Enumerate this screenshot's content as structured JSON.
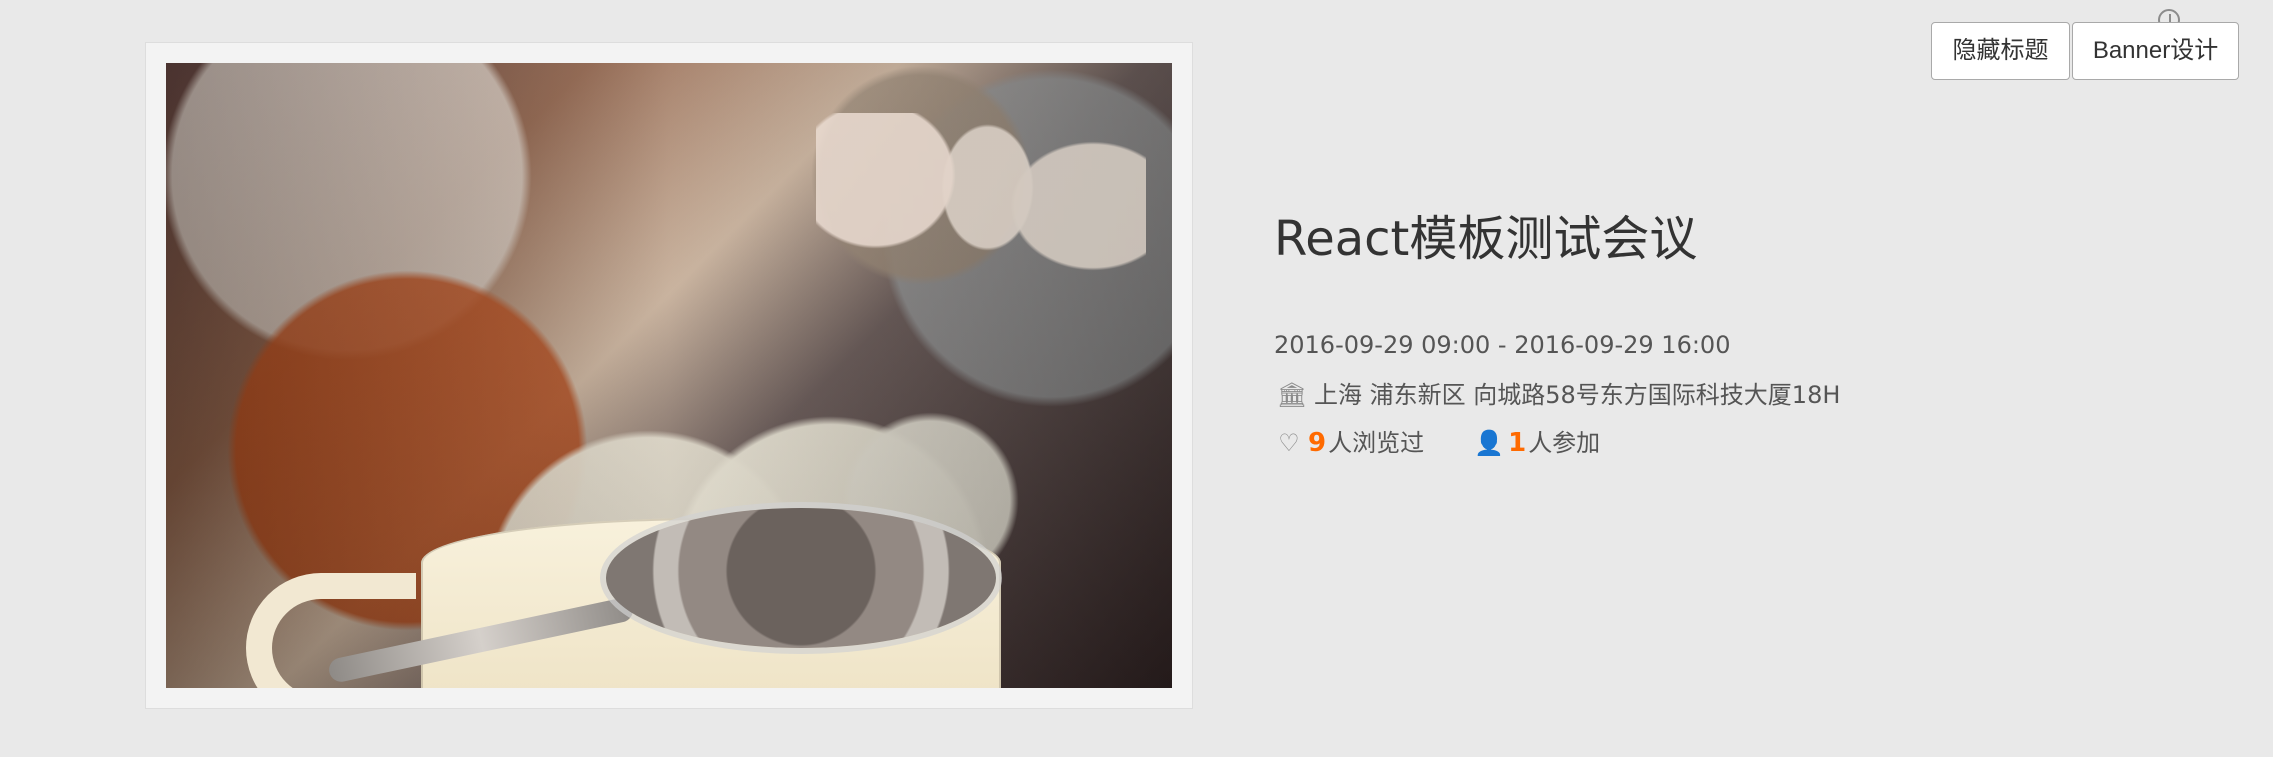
{
  "header_actions": {
    "hide_title_button": "隐藏标题",
    "banner_design_button": "Banner设计"
  },
  "event": {
    "title": "React模板测试会议",
    "datetime_range": "2016-09-29 09:00 - 2016-09-29 16:00",
    "location": "上海 浦东新区 向城路58号东方国际科技大厦18H",
    "views_count": "9",
    "views_label": "人浏览过",
    "participants_count": "1",
    "participants_label": "人参加"
  },
  "icons": {
    "top_small": "clock-icon",
    "location": "bank-icon",
    "views": "heart-icon",
    "participants": "user-icon"
  },
  "colors": {
    "background": "#e9e9e9",
    "accent_number": "#ff6a00",
    "title": "#333333",
    "text": "#555555",
    "button_border": "#a9a9a9"
  }
}
